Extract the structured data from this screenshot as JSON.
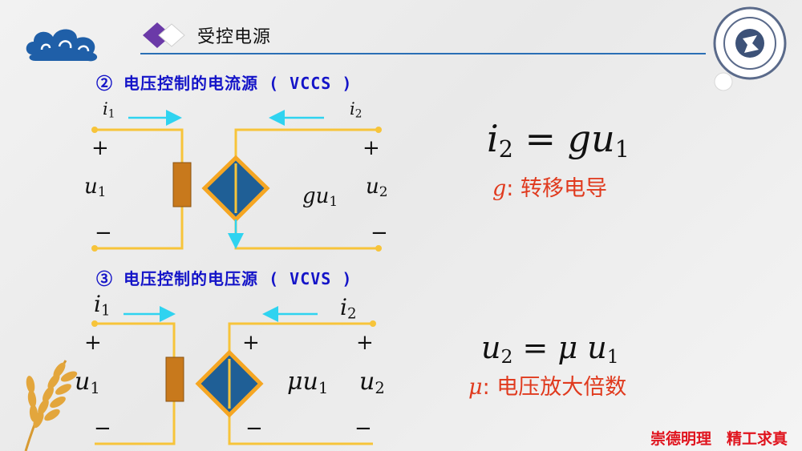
{
  "slide": {
    "title": "受控电源",
    "motto": "崇德明理　精工求真"
  },
  "vccs": {
    "heading": "② 电压控制的电流源 ( VCCS )",
    "i1": {
      "sym": "i",
      "sub": "1"
    },
    "i2": {
      "sym": "i",
      "sub": "2"
    },
    "u1": {
      "sym": "u",
      "sub": "1"
    },
    "u2": {
      "sym": "u",
      "sub": "2"
    },
    "source": {
      "sym": "gu",
      "sub": "1"
    },
    "plus": "+",
    "minus": "−",
    "equation": {
      "lhs": "i",
      "lhs_sub": "2",
      "op": " = ",
      "rhs": "gu",
      "rhs_sub": "1"
    },
    "definition": {
      "sym": "g",
      "text": ": 转移电导"
    }
  },
  "vcvs": {
    "heading": "③ 电压控制的电压源 ( VCVS )",
    "i1": {
      "sym": "i",
      "sub": "1"
    },
    "i2": {
      "sym": "i",
      "sub": "2"
    },
    "u1": {
      "sym": "u",
      "sub": "1"
    },
    "u2": {
      "sym": "u",
      "sub": "2"
    },
    "source": {
      "sym": "μu",
      "sub": "1"
    },
    "plus": "+",
    "minus": "−",
    "equation": {
      "lhs": "u",
      "lhs_sub": "2",
      "op": " = ",
      "rhs": "μ u",
      "rhs_sub": "1"
    },
    "definition": {
      "sym": "μ",
      "text": ": 电压放大倍数"
    }
  },
  "colors": {
    "wire": "#f7c43a",
    "arrow": "#2fd3f0",
    "source_fill": "#1f5f96",
    "source_border": "#f5a623",
    "resistor": "#c8791c",
    "heading": "#1414c8",
    "accent": "#e03a1e"
  },
  "icons": [
    "cloud-emblem-icon",
    "diamond-bullet-icon",
    "university-seal-icon",
    "wheat-icon"
  ]
}
